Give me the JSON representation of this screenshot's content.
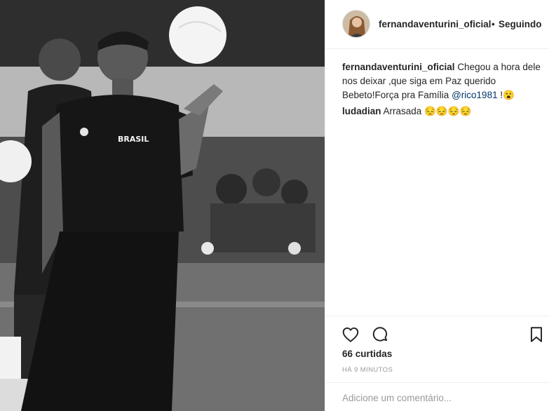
{
  "photo": {
    "jersey_text": "BRASIL"
  },
  "header": {
    "username": "fernandaventurini_oficial",
    "separator": "•",
    "follow_label": "Seguindo"
  },
  "comments": [
    {
      "user": "fernandaventurini_oficial",
      "text_before": "Chegou a hora dele nos deixar ,que siga em Paz querido Bebeto!Força pra Família",
      "mention": "@rico1981",
      "text_after": "!😮"
    },
    {
      "user": "ludadian",
      "text_before": "Arrasada",
      "mention": "",
      "text_after": "😔😔😔😔"
    }
  ],
  "actions": {
    "like_icon": "heart-outline",
    "comment_icon": "speech-bubble-outline",
    "save_icon": "bookmark-outline"
  },
  "likes_label": "66 curtidas",
  "timestamp": "HÁ 9 MINUTOS",
  "add_comment": {
    "placeholder": "Adicione um comentário...",
    "value": ""
  }
}
